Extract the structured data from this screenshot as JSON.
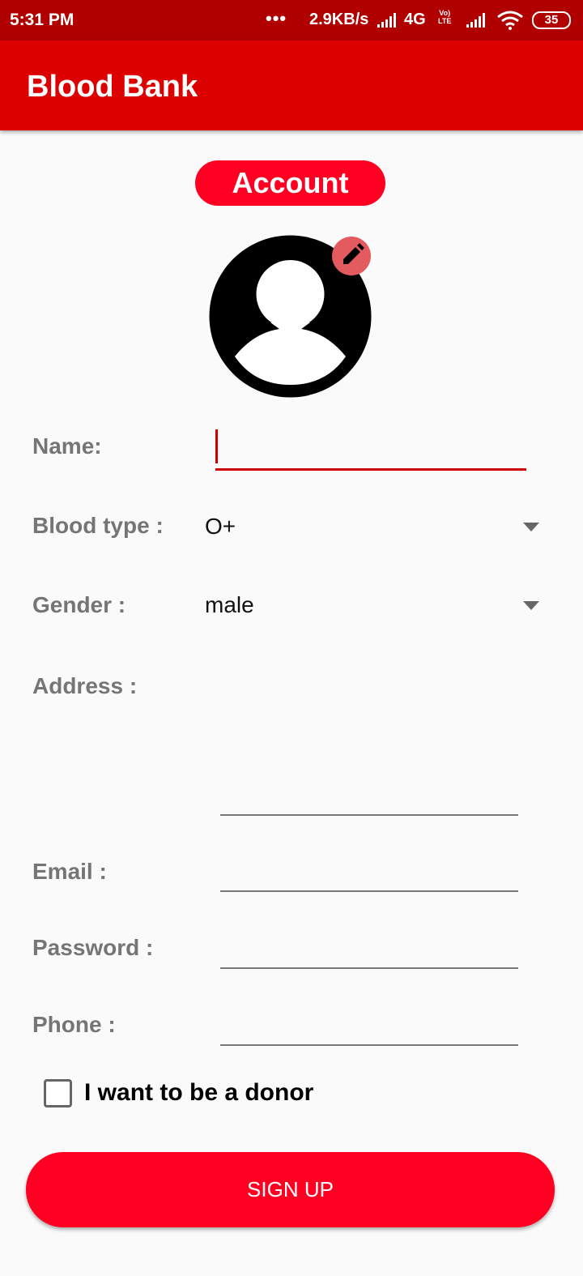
{
  "status_bar": {
    "time": "5:31 PM",
    "dots": "•••",
    "speed": "2.9KB/s",
    "network": "4G",
    "volte_top": "Vo)",
    "volte_bottom": "LTE",
    "battery": "35"
  },
  "app_bar": {
    "title": "Blood Bank"
  },
  "account": {
    "label": "Account"
  },
  "icons": {
    "avatar": "person-placeholder-icon",
    "edit": "pencil-icon",
    "dropdown": "dropdown-arrow-icon"
  },
  "colors": {
    "status_bar": "#b00000",
    "app_bar": "#dc0000",
    "accent": "#ff0022",
    "edit_badge": "#e35a5f"
  },
  "form": {
    "name_label": "Name:",
    "name_value": "",
    "blood_type_label": "Blood type :",
    "blood_type_value": "O+",
    "gender_label": "Gender :",
    "gender_value": "male",
    "address_label": "Address :",
    "address_value": "",
    "email_label": "Email :",
    "email_value": "",
    "password_label": "Password :",
    "password_value": "",
    "phone_label": "Phone :",
    "phone_value": ""
  },
  "donor": {
    "label": "I want to be a donor",
    "checked": false
  },
  "signup": {
    "label": "SIGN UP"
  }
}
